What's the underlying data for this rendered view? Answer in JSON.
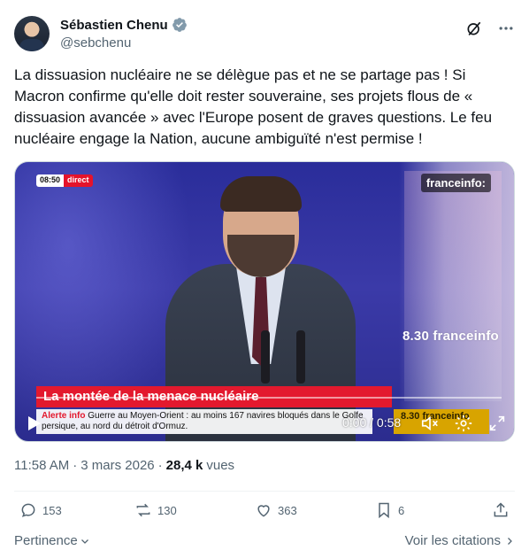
{
  "author": {
    "name": "Sébastien Chenu",
    "handle": "@sebchenu",
    "verified_color": "#829aab"
  },
  "header_icons": [
    "grok-icon",
    "more-icon"
  ],
  "tweet": {
    "text": "La dissuasion nucléaire ne se délègue pas et ne se partage pas ! Si Macron confirme qu'elle doit rester souveraine, ses projets flous de « dissuasion avancée » avec l'Europe posent de graves questions. Le feu nucléaire engage la Nation, aucune ambiguïté n'est permise !"
  },
  "video": {
    "live_time": "08:50",
    "live_label": "direct",
    "channel_logo": "franceinfo:",
    "studio_brand": "8.30 franceinfo",
    "headline": "La montée de la menace nucléaire",
    "ticker_alert": "Alerte info",
    "ticker_text": "Guerre au Moyen-Orient : au moins 167 navires bloqués dans le Golfe persique, au nord du détroit d'Ormuz.",
    "ticker_right": "8.30 franceinfo",
    "time_readout": "0:00 / 0:58",
    "progress": 0.0,
    "accent_red": "#e3192e",
    "accent_yellow": "#d8a400"
  },
  "meta": {
    "time": "11:58 AM",
    "separator": "·",
    "date": "3 mars 2026",
    "views_count": "28,4 k",
    "views_label": "vues"
  },
  "actions": {
    "replies": "153",
    "reposts": "130",
    "likes": "363",
    "bookmarks": "6"
  },
  "footer": {
    "relevance_label": "Pertinence",
    "quotes_label": "Voir les citations"
  }
}
